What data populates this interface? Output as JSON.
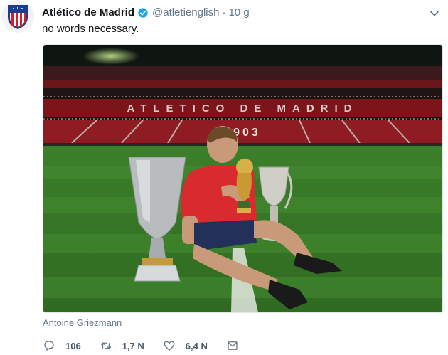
{
  "tweet": {
    "author_name": "Atlético de Madrid",
    "handle": "@atletienglish",
    "separator": "·",
    "time": "10 g",
    "text": "no words necessary.",
    "media_caption": "Antoine Griezmann",
    "stadium_banner": "1903",
    "stadium_name": "ATLETICO DE MADRID"
  },
  "actions": {
    "replies": "106",
    "retweets": "1,7 N",
    "likes": "6,4 N"
  },
  "colors": {
    "pitch": "#3f8a2a",
    "stands": "#8e1c22",
    "verified": "#1da1f2",
    "secondary_text": "#657786"
  },
  "icons": [
    "atletico-crest-icon",
    "verified-badge-icon",
    "chevron-down-icon",
    "reply-icon",
    "retweet-icon",
    "like-icon",
    "dm-icon"
  ]
}
